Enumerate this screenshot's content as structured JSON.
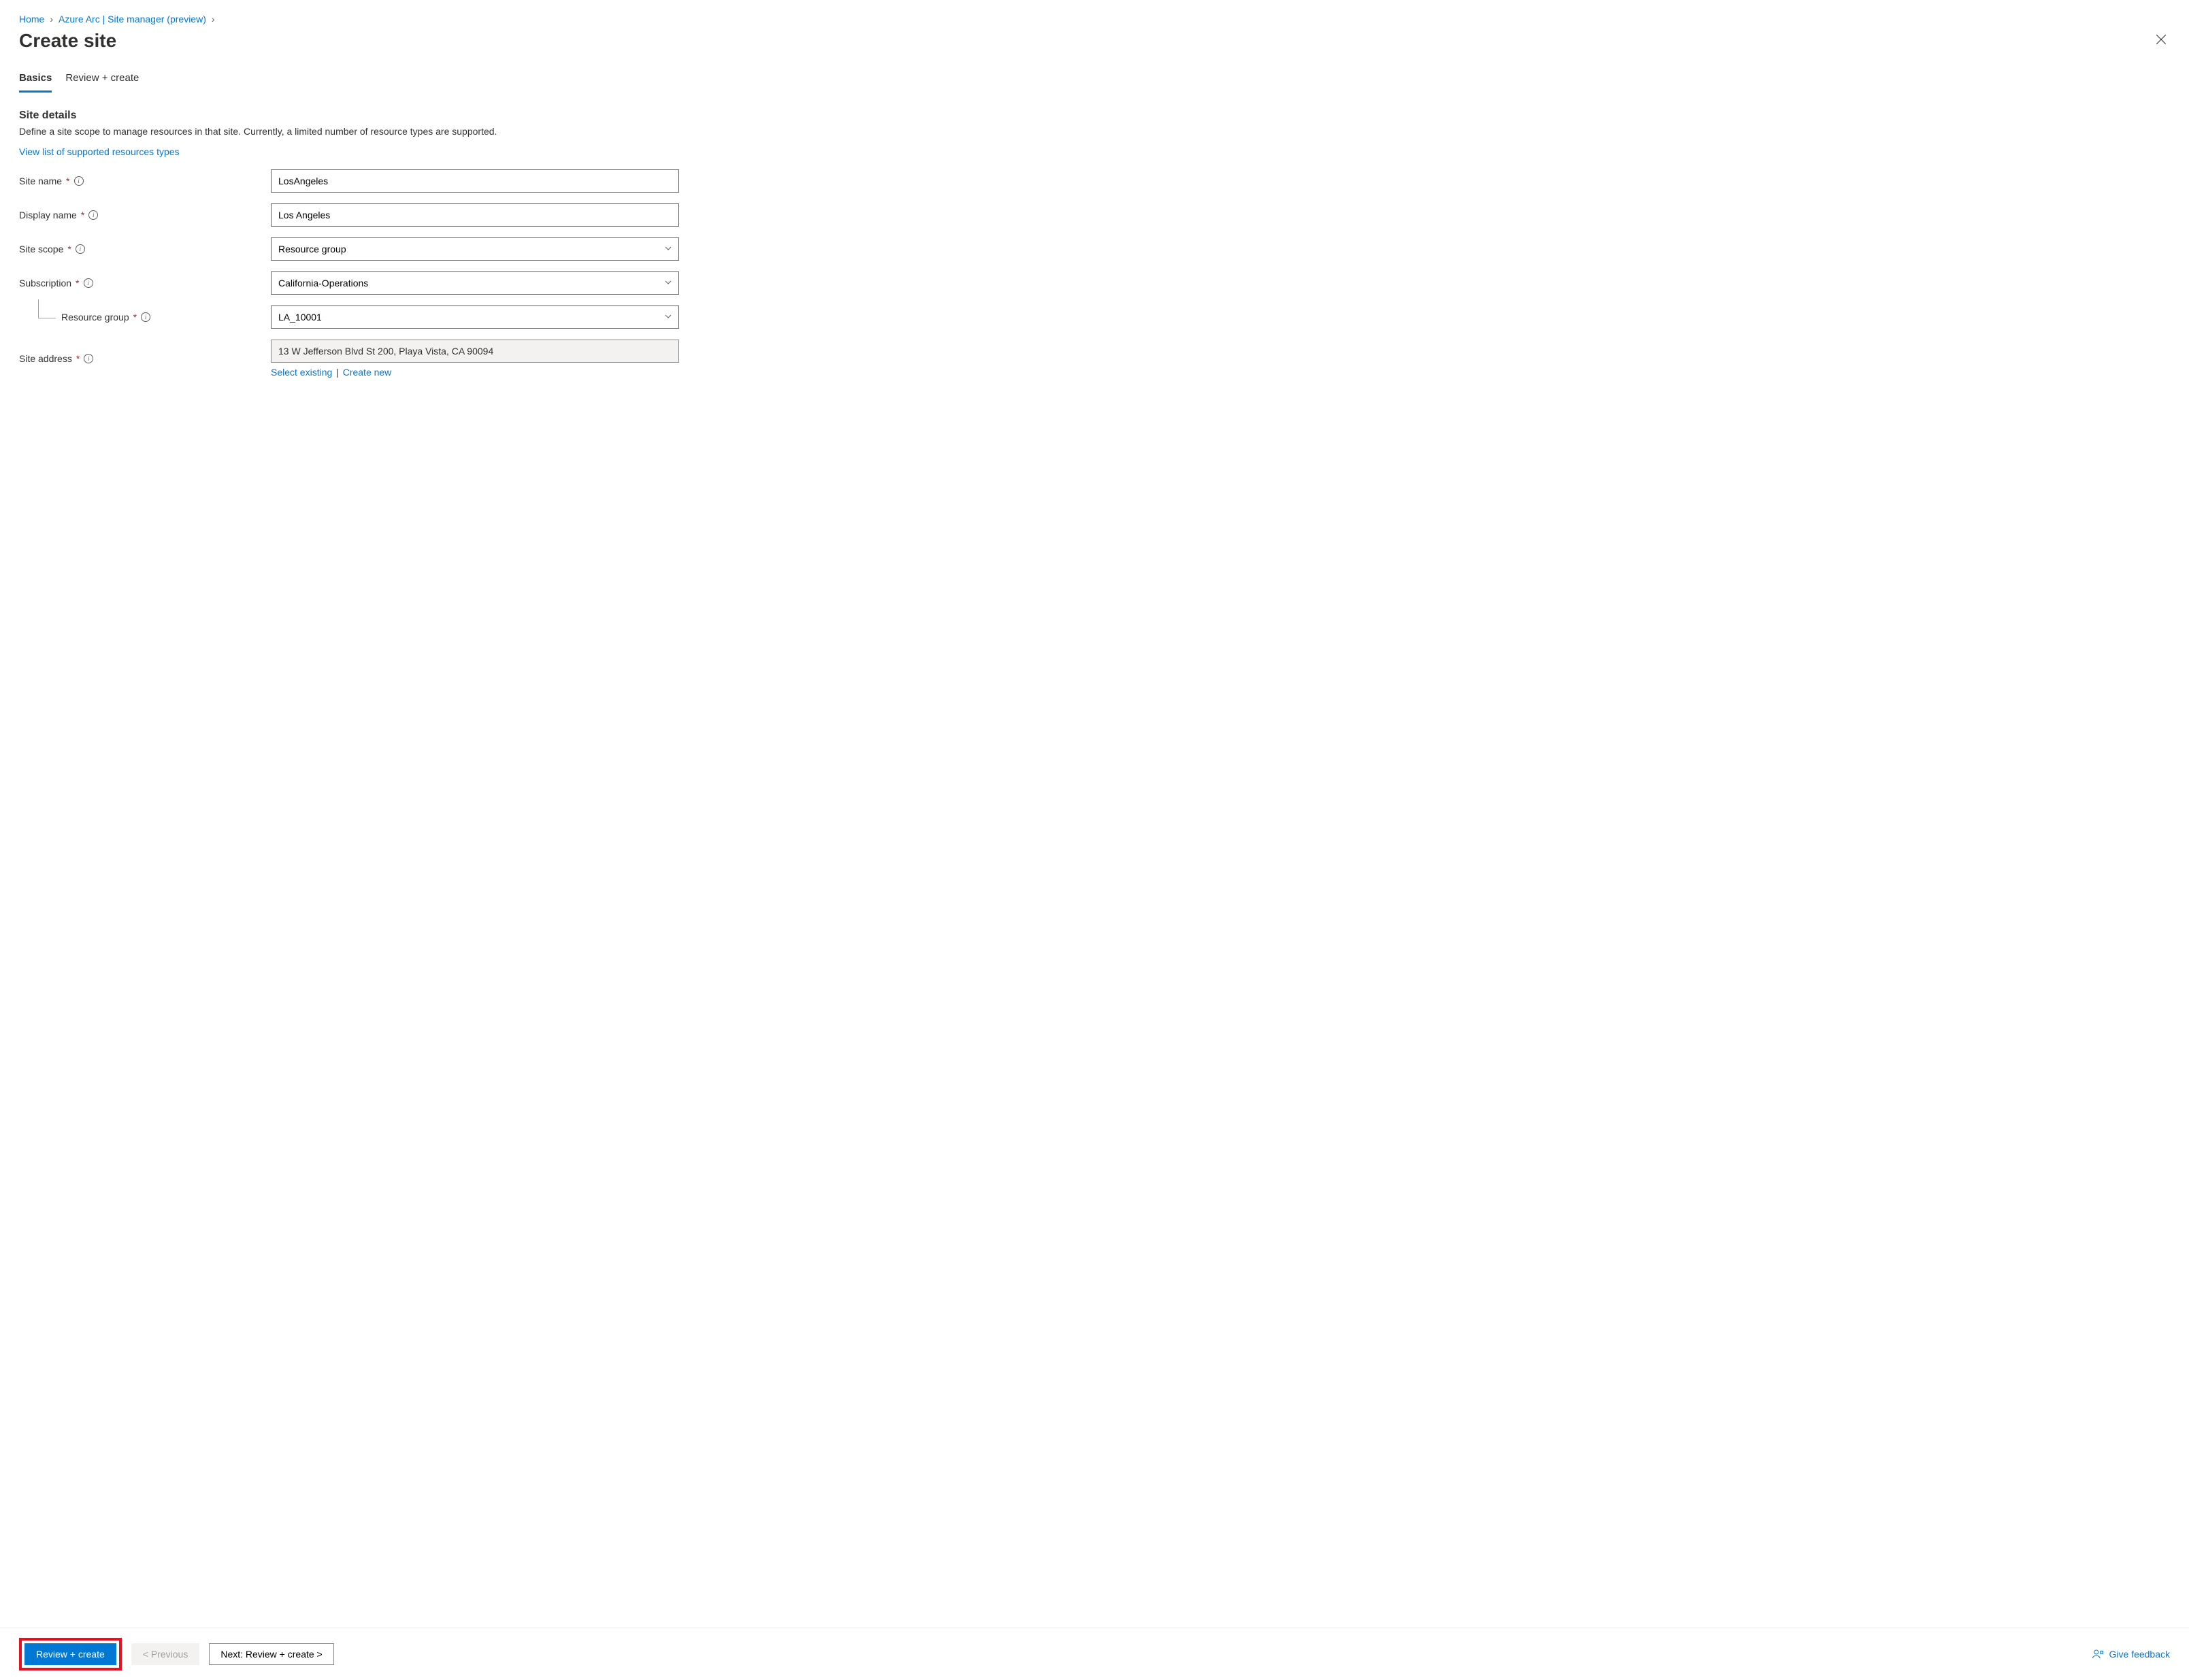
{
  "breadcrumb": {
    "home": "Home",
    "arc": "Azure Arc | Site manager (preview)"
  },
  "title": "Create site",
  "tabs": {
    "basics": "Basics",
    "review": "Review + create"
  },
  "section": {
    "heading": "Site details",
    "description": "Define a site scope to manage resources in that site. Currently, a limited number of resource types are supported.",
    "supported_link": "View list of supported resources types"
  },
  "labels": {
    "site_name": "Site name",
    "display_name": "Display name",
    "site_scope": "Site scope",
    "subscription": "Subscription",
    "resource_group": "Resource group",
    "site_address": "Site address"
  },
  "values": {
    "site_name": "LosAngeles",
    "display_name": "Los Angeles",
    "site_scope": "Resource group",
    "subscription": "California-Operations",
    "resource_group": "LA_10001",
    "site_address": "13 W Jefferson Blvd St 200, Playa Vista, CA 90094"
  },
  "address_actions": {
    "select_existing": "Select existing",
    "create_new": "Create new"
  },
  "footer": {
    "review_create": "Review + create",
    "previous": "< Previous",
    "next": "Next: Review + create >",
    "feedback": "Give feedback"
  }
}
